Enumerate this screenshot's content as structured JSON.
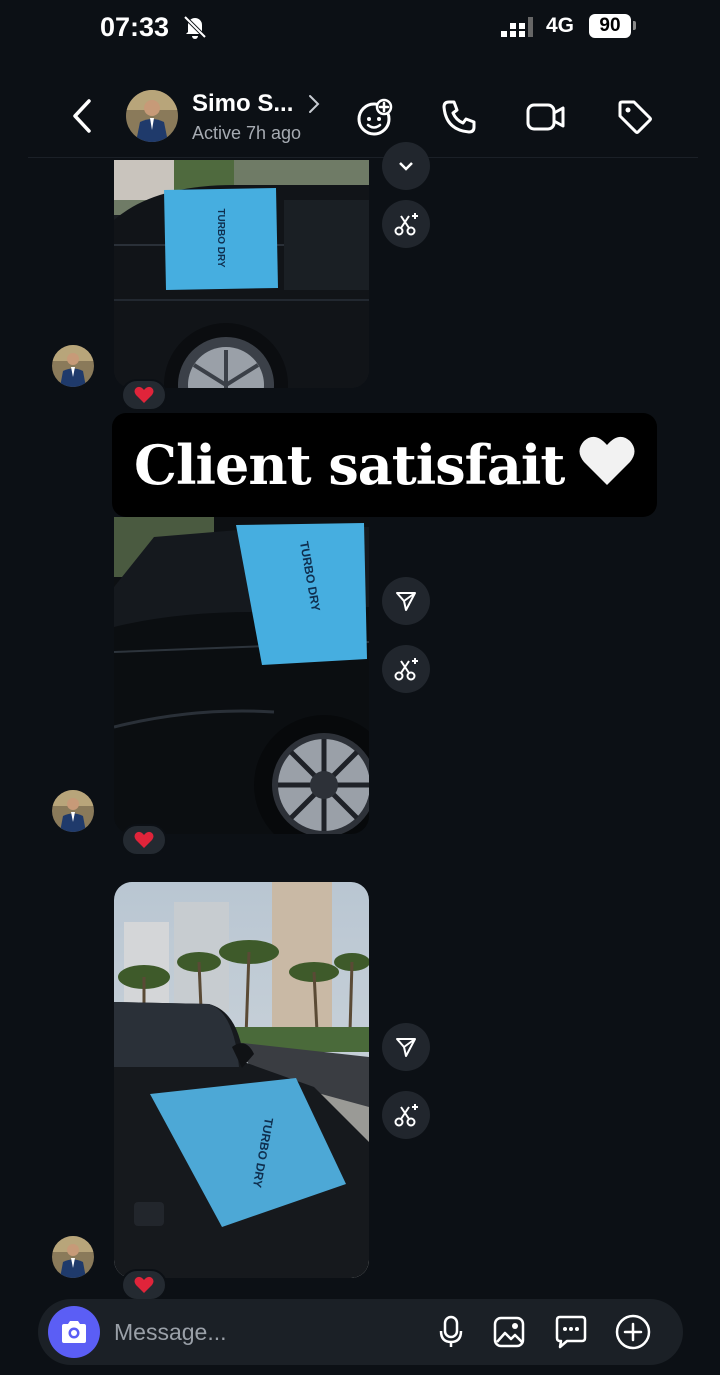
{
  "status_bar": {
    "time": "07:33",
    "network": "4G",
    "battery": "90"
  },
  "header": {
    "contact_name": "Simo S...",
    "contact_status": "Active 7h ago"
  },
  "messages": [
    {
      "photo_label": "TURBO DRY",
      "reaction": "❤️"
    },
    {
      "photo_label": "TURBO DRY",
      "reaction": "❤️"
    },
    {
      "photo_label": "TURBO DRY",
      "reaction": "❤️"
    }
  ],
  "caption": {
    "text": "Client satisfait",
    "emoji_name": "white-heart-icon"
  },
  "composer": {
    "placeholder": "Message..."
  },
  "colors": {
    "accent": "#5b5ef5",
    "background": "#0c1015",
    "towel_blue": "#46aee0",
    "reaction_red": "#e0243a"
  }
}
